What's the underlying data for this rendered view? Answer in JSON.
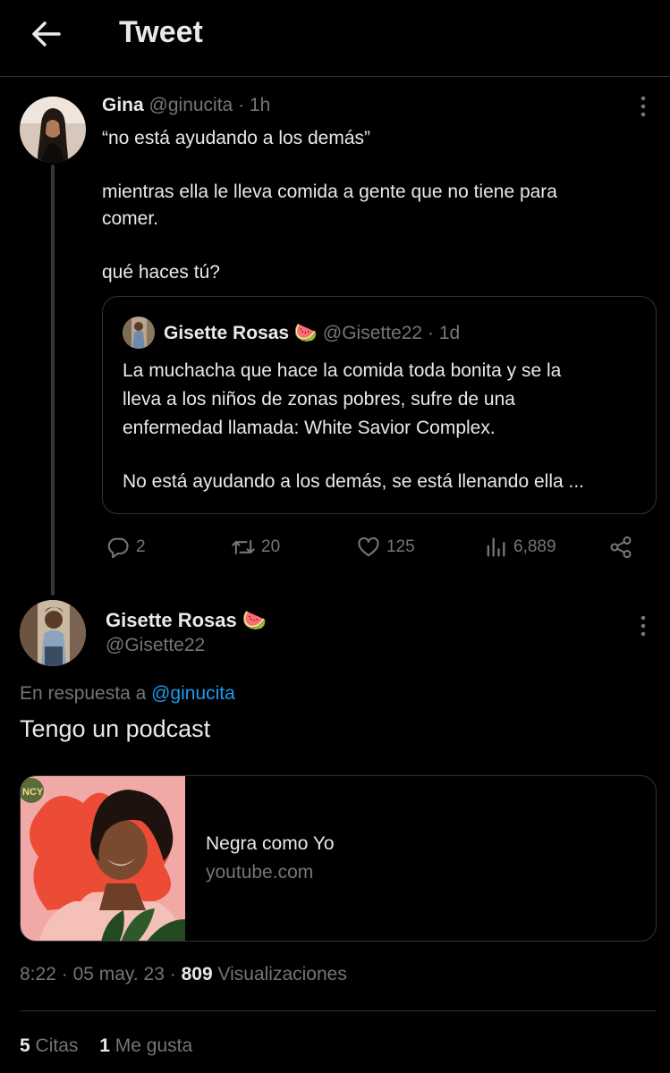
{
  "header": {
    "title": "Tweet"
  },
  "tweet": {
    "author_name": "Gina",
    "author_handle": "@ginucita",
    "separator": "·",
    "time": "1h",
    "text_lines": [
      "“no está ayudando a los demás”",
      "mientras ella le lleva comida a gente que no tiene para",
      "comer.",
      "qué haces tú?"
    ],
    "quoted": {
      "author_name": "Gisette Rosas",
      "author_emoji": "🍉",
      "author_handle": "@Gisette22",
      "separator": "·",
      "time": "1d",
      "text_lines": [
        "La muchacha que hace la comida toda bonita y se la",
        "lleva a los niños de zonas pobres, sufre de una",
        "enfermedad llamada: White Savior Complex.",
        "No está ayudando a los demás, se está llenando ella ..."
      ]
    },
    "actions": {
      "replies": "2",
      "retweets": "20",
      "likes": "125",
      "views": "6,889"
    }
  },
  "reply": {
    "author_name": "Gisette Rosas",
    "author_emoji": "🍉",
    "author_handle": "@Gisette22",
    "reply_prefix": "En respuesta a",
    "reply_to": "@ginucita",
    "text": "Tengo un podcast",
    "card": {
      "title": "Negra como Yo",
      "domain": "youtube.com",
      "thumb_badge": "NCY"
    },
    "timestamp": {
      "time": "8:22",
      "separator": "·",
      "date": "05 may. 23",
      "views_count": "809",
      "views_label": "Visualizaciones"
    },
    "stats": {
      "quotes_count": "5",
      "quotes_label": "Citas",
      "likes_count": "1",
      "likes_label": "Me gusta"
    }
  },
  "colors": {
    "background": "#000000",
    "text": "#e7e9ea",
    "muted": "#71767b",
    "border": "#2f3336",
    "link": "#1d9bf0"
  }
}
